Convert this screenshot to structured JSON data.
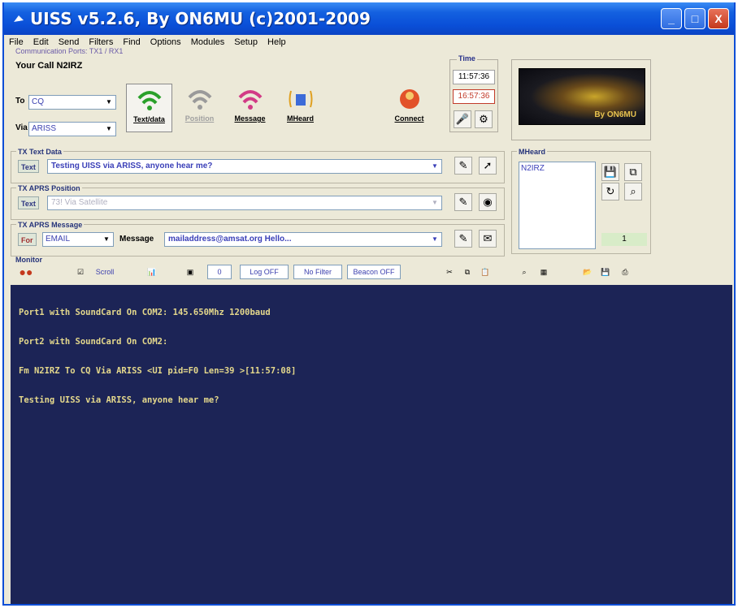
{
  "window": {
    "title": "UISS v5.2.6, By ON6MU (c)2001-2009",
    "minimize_glyph": "_",
    "maximize_glyph": "□",
    "close_glyph": "X"
  },
  "menu": [
    "File",
    "Edit",
    "Send",
    "Filters",
    "Find",
    "Options",
    "Modules",
    "Setup",
    "Help"
  ],
  "comm_ports": "Communication Ports: TX1 / RX1",
  "your_call": {
    "label": "Your Call",
    "value": "N2IRZ"
  },
  "to": {
    "label": "To",
    "value": "CQ"
  },
  "via": {
    "label": "Via",
    "value": "ARISS"
  },
  "function_buttons": [
    {
      "name": "F5",
      "label": "Text/data",
      "selected": true
    },
    {
      "name": "F6",
      "label": "Position",
      "disabled": true
    },
    {
      "name": "F7",
      "label": "Message"
    },
    {
      "name": "F8",
      "label": "MHeard"
    }
  ],
  "connect_label": "Connect",
  "time": {
    "label": "Time",
    "local": "11:57:36",
    "utc": "16:57:36"
  },
  "logo_text": "By ON6MU",
  "tx_text": {
    "title": "TX Text Data",
    "tag": "Text",
    "value": "Testing UISS via ARISS, anyone hear me?"
  },
  "tx_aprs_position": {
    "title": "TX APRS Position",
    "tag": "Text",
    "value": "73! Via Satellite"
  },
  "tx_aprs_message": {
    "title": "TX APRS Message",
    "for_label": "For",
    "for_value": "EMAIL",
    "message_label": "Message",
    "message_value": "mailaddress@amsat.org Hello..."
  },
  "mheard": {
    "title": "MHeard",
    "entries": [
      "N2IRZ"
    ],
    "count": "1"
  },
  "monitor": {
    "title": "Monitor",
    "scroll_label": "Scroll",
    "counter": "0",
    "log_label": "Log OFF",
    "filter_label": "No Filter",
    "beacon_label": "Beacon OFF",
    "lines": [
      "Port1 with SoundCard On COM2: 145.650Mhz 1200baud",
      "Port2 with SoundCard On COM2:",
      "Fm N2IRZ To CQ Via ARISS <UI pid=F0 Len=39 >[11:57:08]",
      "Testing UISS via ARISS, anyone hear me?"
    ]
  },
  "colors": {
    "titlebar": "#0a4fd8",
    "monitor_bg": "#1c2456",
    "monitor_text": "#e4d88c",
    "window_bg": "#ece9d8"
  }
}
